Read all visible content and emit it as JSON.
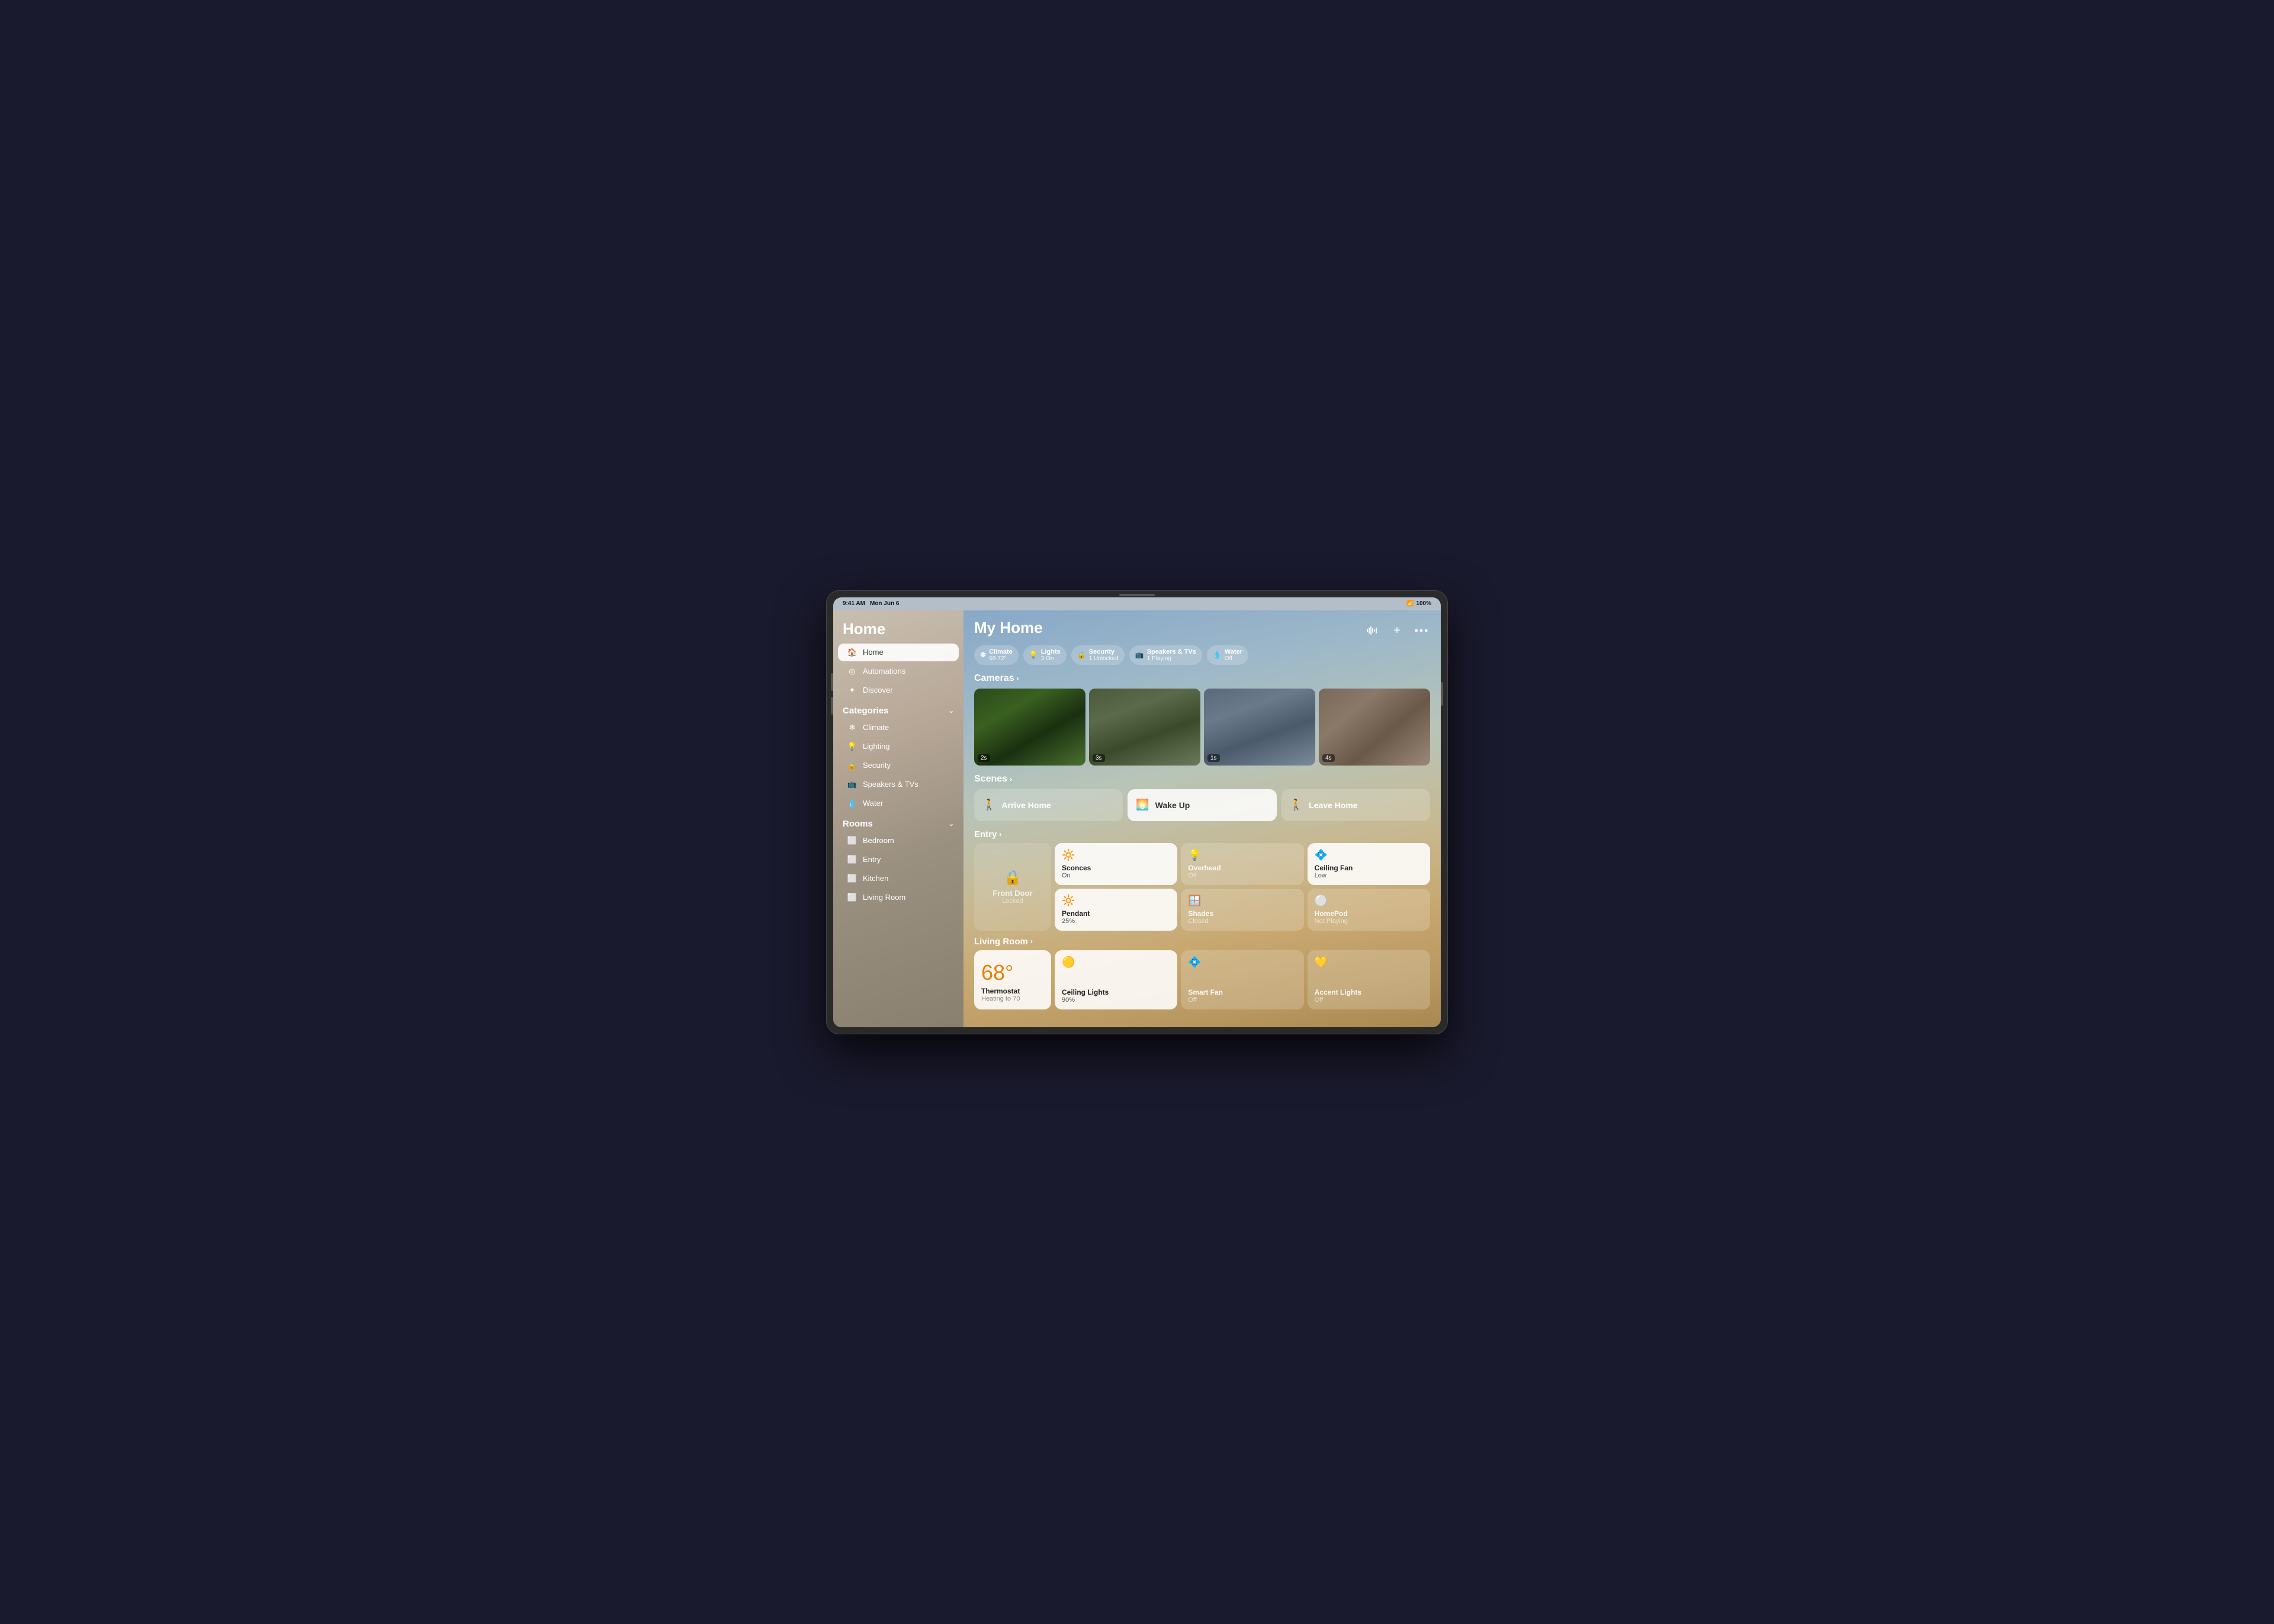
{
  "device": {
    "status_bar": {
      "time": "9:41 AM",
      "date": "Mon Jun 6",
      "wifi": "WiFi",
      "battery": "100%"
    }
  },
  "sidebar": {
    "title": "Home",
    "nav_items": [
      {
        "id": "home",
        "label": "Home",
        "icon": "🏠",
        "active": true
      },
      {
        "id": "automations",
        "label": "Automations",
        "icon": "◎"
      },
      {
        "id": "discover",
        "label": "Discover",
        "icon": "✦"
      }
    ],
    "categories_title": "Categories",
    "categories": [
      {
        "id": "climate",
        "label": "Climate",
        "icon": "❄"
      },
      {
        "id": "lighting",
        "label": "Lighting",
        "icon": "💡"
      },
      {
        "id": "security",
        "label": "Security",
        "icon": "🔒"
      },
      {
        "id": "speakers",
        "label": "Speakers & TVs",
        "icon": "📺"
      },
      {
        "id": "water",
        "label": "Water",
        "icon": "💧"
      }
    ],
    "rooms_title": "Rooms",
    "rooms": [
      {
        "id": "bedroom",
        "label": "Bedroom",
        "icon": "⬜"
      },
      {
        "id": "entry",
        "label": "Entry",
        "icon": "⬜"
      },
      {
        "id": "kitchen",
        "label": "Kitchen",
        "icon": "⬜"
      },
      {
        "id": "living_room",
        "label": "Living Room",
        "icon": "⬜"
      }
    ]
  },
  "main": {
    "title": "My Home",
    "header_actions": {
      "waveform": "waveform",
      "add": "+",
      "more": "···"
    },
    "chips": [
      {
        "id": "climate",
        "icon": "❄",
        "label": "Climate",
        "sublabel": "68-72°"
      },
      {
        "id": "lights",
        "icon": "💡",
        "label": "Lights",
        "sublabel": "3 On"
      },
      {
        "id": "security",
        "icon": "🔒",
        "label": "Security",
        "sublabel": "1 Unlocked"
      },
      {
        "id": "speakers",
        "icon": "📺",
        "label": "Speakers & TVs",
        "sublabel": "1 Playing"
      },
      {
        "id": "water",
        "icon": "💧",
        "label": "Water",
        "sublabel": "Off"
      }
    ],
    "cameras_section": {
      "label": "Cameras",
      "chevron": "›",
      "feeds": [
        {
          "id": "cam1",
          "timer": "2s",
          "bg": "cam1"
        },
        {
          "id": "cam2",
          "timer": "3s",
          "bg": "cam2"
        },
        {
          "id": "cam3",
          "timer": "1s",
          "bg": "cam3"
        },
        {
          "id": "cam4",
          "timer": "4s",
          "bg": "cam3"
        }
      ]
    },
    "scenes_section": {
      "label": "Scenes",
      "chevron": "›",
      "scenes": [
        {
          "id": "arrive_home",
          "icon": "🚶",
          "label": "Arrive Home",
          "active": false
        },
        {
          "id": "wake_up",
          "icon": "🌅",
          "label": "Wake Up",
          "active": true
        },
        {
          "id": "leave_home",
          "icon": "🚶",
          "label": "Leave Home",
          "active": false
        }
      ]
    },
    "entry_section": {
      "label": "Entry",
      "chevron": "›",
      "devices": [
        {
          "id": "front_door",
          "icon": "🔒",
          "label": "Front Door",
          "status": "Locked",
          "active": false,
          "span": true
        },
        {
          "id": "sconces",
          "icon": "💛",
          "label": "Sconces",
          "status": "On",
          "active": true
        },
        {
          "id": "overhead",
          "icon": "💡",
          "label": "Overhead",
          "status": "Off",
          "active": false
        },
        {
          "id": "ceiling_fan",
          "icon": "💠",
          "label": "Ceiling Fan",
          "status": "Low",
          "active": true
        },
        {
          "id": "pendant",
          "icon": "💛",
          "label": "Pendant",
          "status": "25%",
          "active": true
        },
        {
          "id": "shades",
          "icon": "🟦",
          "label": "Shades",
          "status": "Closed",
          "active": false
        },
        {
          "id": "homepod",
          "icon": "⚪",
          "label": "HomePod",
          "status": "Not Playing",
          "active": false
        }
      ]
    },
    "living_room_section": {
      "label": "Living Room",
      "chevron": "›",
      "devices": [
        {
          "id": "thermostat",
          "temp": "68°",
          "label": "Thermostat",
          "status": "Heating to 70",
          "active": true
        },
        {
          "id": "ceiling_lights",
          "icon": "🟡",
          "label": "Ceiling Lights",
          "status": "90%",
          "active": true
        },
        {
          "id": "smart_fan",
          "icon": "💠",
          "label": "Smart Fan",
          "status": "Off",
          "active": false
        },
        {
          "id": "accent_lights",
          "icon": "💛",
          "label": "Accent Lights",
          "status": "Off",
          "active": false
        }
      ]
    }
  }
}
